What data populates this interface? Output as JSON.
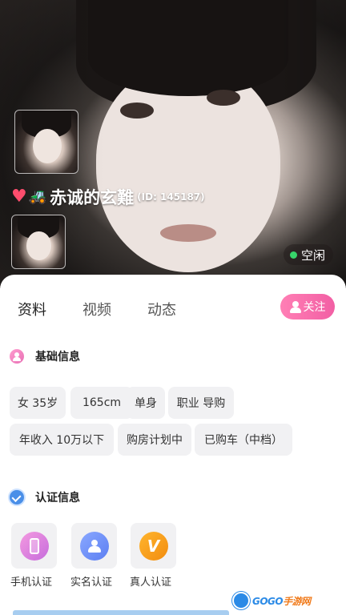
{
  "profile": {
    "nickname": "赤诚的玄難",
    "id_label": "(ID: 145187)",
    "status": "空闲",
    "badges": [
      "heart-icon",
      "tractor-icon"
    ]
  },
  "tabs": [
    {
      "label": "资料",
      "active": true
    },
    {
      "label": "视频",
      "active": false
    },
    {
      "label": "动态",
      "active": false
    }
  ],
  "follow_button": {
    "label": "关注"
  },
  "basic_info": {
    "title": "基础信息",
    "tags": [
      "女 35岁",
      "165cm",
      "单身",
      "职业 导购",
      "年收入 10万以下",
      "购房计划中",
      "已购车（中档）"
    ]
  },
  "certification": {
    "title": "认证信息",
    "items": [
      {
        "label": "手机认证",
        "icon": "phone-icon"
      },
      {
        "label": "实名认证",
        "icon": "person-verified-icon"
      },
      {
        "label": "真人认证",
        "icon": "v-badge-icon",
        "glyph": "V"
      }
    ]
  },
  "watermark": {
    "brand_a": "GOGO",
    "brand_b": "手游网"
  },
  "colors": {
    "accent_pink": "#f25fa4",
    "online_green": "#37d46a",
    "verify_blue": "#4a8fe8"
  }
}
